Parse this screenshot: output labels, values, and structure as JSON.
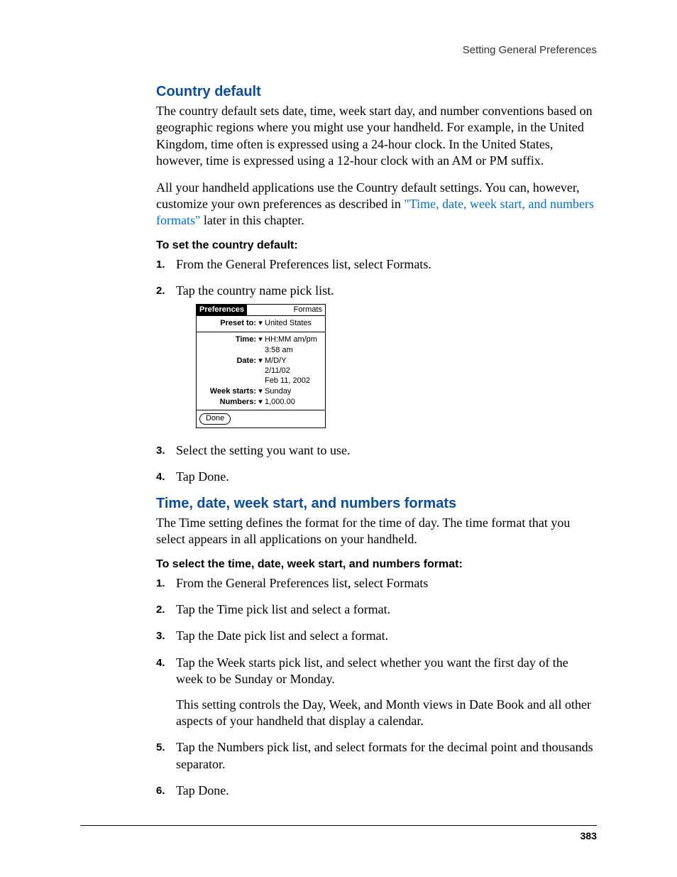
{
  "header": {
    "running": "Setting General Preferences"
  },
  "section1": {
    "title": "Country default",
    "p1": "The country default sets date, time, week start day, and number conventions based on geographic regions where you might use your handheld. For example, in the United Kingdom, time often is expressed using a 24-hour clock. In the United States, however, time is expressed using a 12-hour clock with an AM or PM suffix.",
    "p2a": "All your handheld applications use the Country default settings. You can, however, customize your own preferences as described in ",
    "p2link": "\"Time, date, week start, and numbers formats\"",
    "p2b": " later in this chapter.",
    "procTitle": "To set the country default:",
    "steps": {
      "s1": "From the General Preferences list, select Formats.",
      "s2": "Tap the country name pick list.",
      "s3": "Select the setting you want to use.",
      "s4": "Tap Done."
    }
  },
  "palm": {
    "title": "Preferences",
    "corner": "Formats",
    "preset_label": "Preset to:",
    "preset_value": "United States",
    "time_label": "Time:",
    "time_value": "HH:MM am/pm",
    "time_sample": "3:58 am",
    "date_label": "Date:",
    "date_value": "M/D/Y",
    "date_sample1": "2/11/02",
    "date_sample2": "Feb 11, 2002",
    "week_label": "Week starts:",
    "week_value": "Sunday",
    "numbers_label": "Numbers:",
    "numbers_value": "1,000.00",
    "done": "Done"
  },
  "section2": {
    "title": "Time, date, week start, and numbers formats",
    "p1": "The Time setting defines the format for the time of day. The time format that you select appears in all applications on your handheld.",
    "procTitle": "To select the time, date, week start, and numbers format:",
    "steps": {
      "s1": "From the General Preferences list, select Formats",
      "s2": "Tap the Time pick list and select a format.",
      "s3": "Tap the Date pick list and select a format.",
      "s4": "Tap the Week starts pick list, and select whether you want the first day of the week to be Sunday or Monday.",
      "s4b": "This setting controls the Day, Week, and Month views in Date Book and all other aspects of your handheld that display a calendar.",
      "s5": "Tap the Numbers pick list, and select formats for the decimal point and thousands separator.",
      "s6": "Tap Done."
    }
  },
  "footer": {
    "page": "383"
  }
}
